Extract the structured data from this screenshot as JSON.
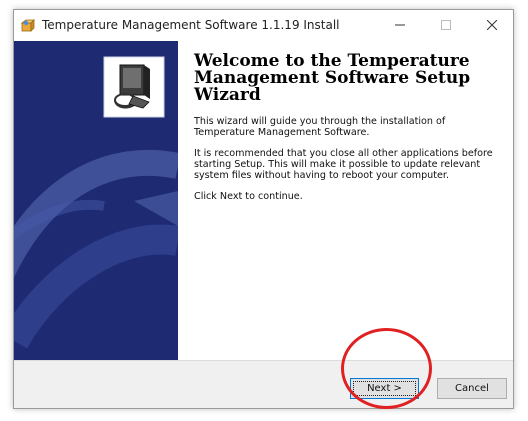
{
  "window": {
    "title": "Temperature Management Software 1.1.19 Install"
  },
  "content": {
    "heading": "Welcome to the Temperature Management Software Setup Wizard",
    "intro": "This wizard will guide you through the installation of Temperature Management Software.",
    "recommend": "It is recommended that you close all other applications before starting Setup. This will make it possible to update relevant system files without having to reboot your computer.",
    "continue": "Click Next to continue."
  },
  "buttons": {
    "next": "Next >",
    "cancel": "Cancel"
  },
  "icons": {
    "title": "installer-icon",
    "banner": "setup-computer-icon"
  },
  "colors": {
    "banner": "#1e2a72",
    "highlight": "#e02121",
    "focus_border": "#0078d7"
  }
}
